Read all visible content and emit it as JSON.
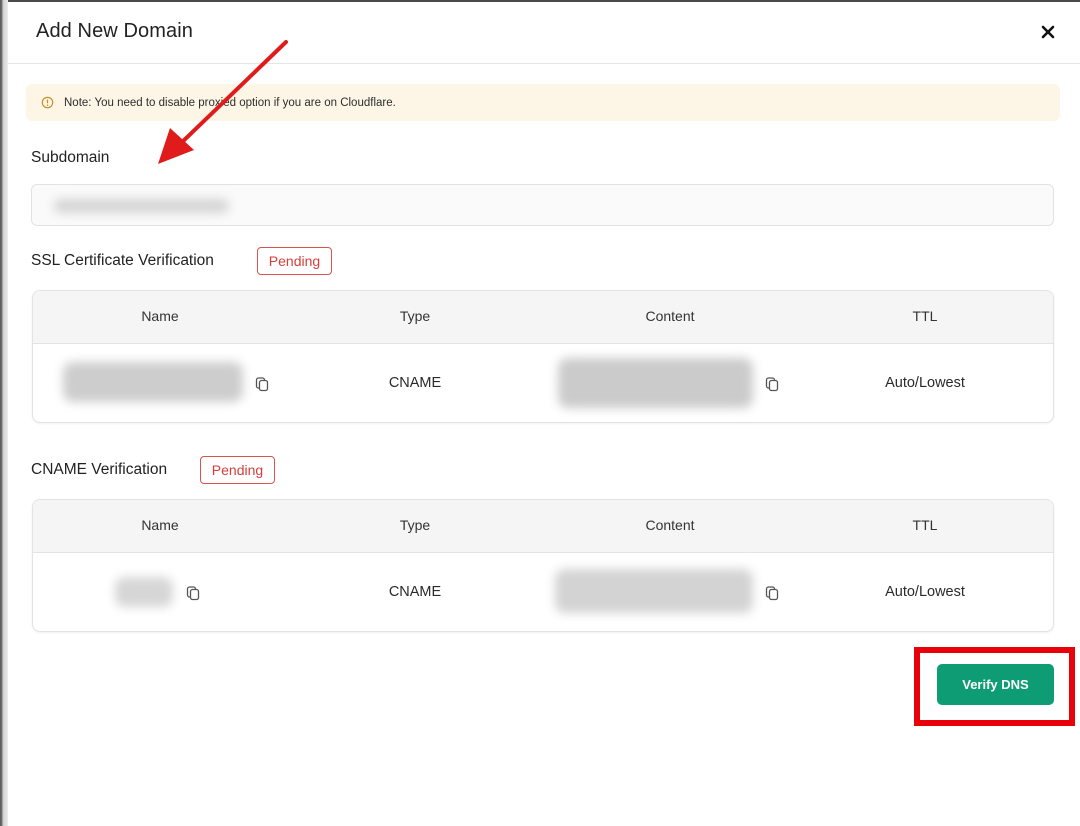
{
  "modal": {
    "title": "Add New Domain"
  },
  "note": {
    "text": "Note: You need to disable proxied option if you are on Cloudflare.",
    "icon": "info-circle-icon",
    "background": "#fdf6e6"
  },
  "subdomain": {
    "label": "Subdomain",
    "value": ""
  },
  "ssl_section": {
    "title": "SSL Certificate Verification",
    "status": "Pending",
    "columns": [
      "Name",
      "Type",
      "Content",
      "TTL"
    ],
    "rows": [
      {
        "name": "",
        "type": "CNAME",
        "content": "",
        "ttl": "Auto/Lowest"
      }
    ]
  },
  "cname_section": {
    "title": "CNAME Verification",
    "status": "Pending",
    "columns": [
      "Name",
      "Type",
      "Content",
      "TTL"
    ],
    "rows": [
      {
        "name": "",
        "type": "CNAME",
        "content": "",
        "ttl": "Auto/Lowest"
      }
    ]
  },
  "actions": {
    "verify_label": "Verify DNS"
  },
  "colors": {
    "accent": "#0e9c75",
    "pending": "#d43f3a",
    "highlight": "#e8000b"
  }
}
